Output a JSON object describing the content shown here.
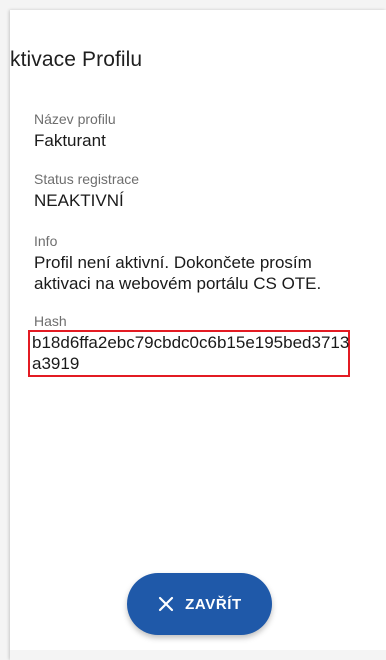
{
  "dialog": {
    "title": "ktivace Profilu",
    "fields": [
      {
        "label": "Název profilu",
        "value": "Fakturant"
      },
      {
        "label": "Status registrace",
        "value": "NEAKTIVNÍ"
      },
      {
        "label": "Info",
        "value": "Profil není aktivní. Dokončete prosím aktivaci na webovém portálu CS OTE."
      },
      {
        "label": "Hash",
        "value": "b18d6ffa2ebc79cbdc0c6b15e195bed3713a3919"
      }
    ],
    "close_button": {
      "label": "ZAVŘÍT",
      "icon": "close-icon"
    }
  },
  "colors": {
    "accent": "#1f59a9",
    "highlight_border": "#e31b23"
  }
}
